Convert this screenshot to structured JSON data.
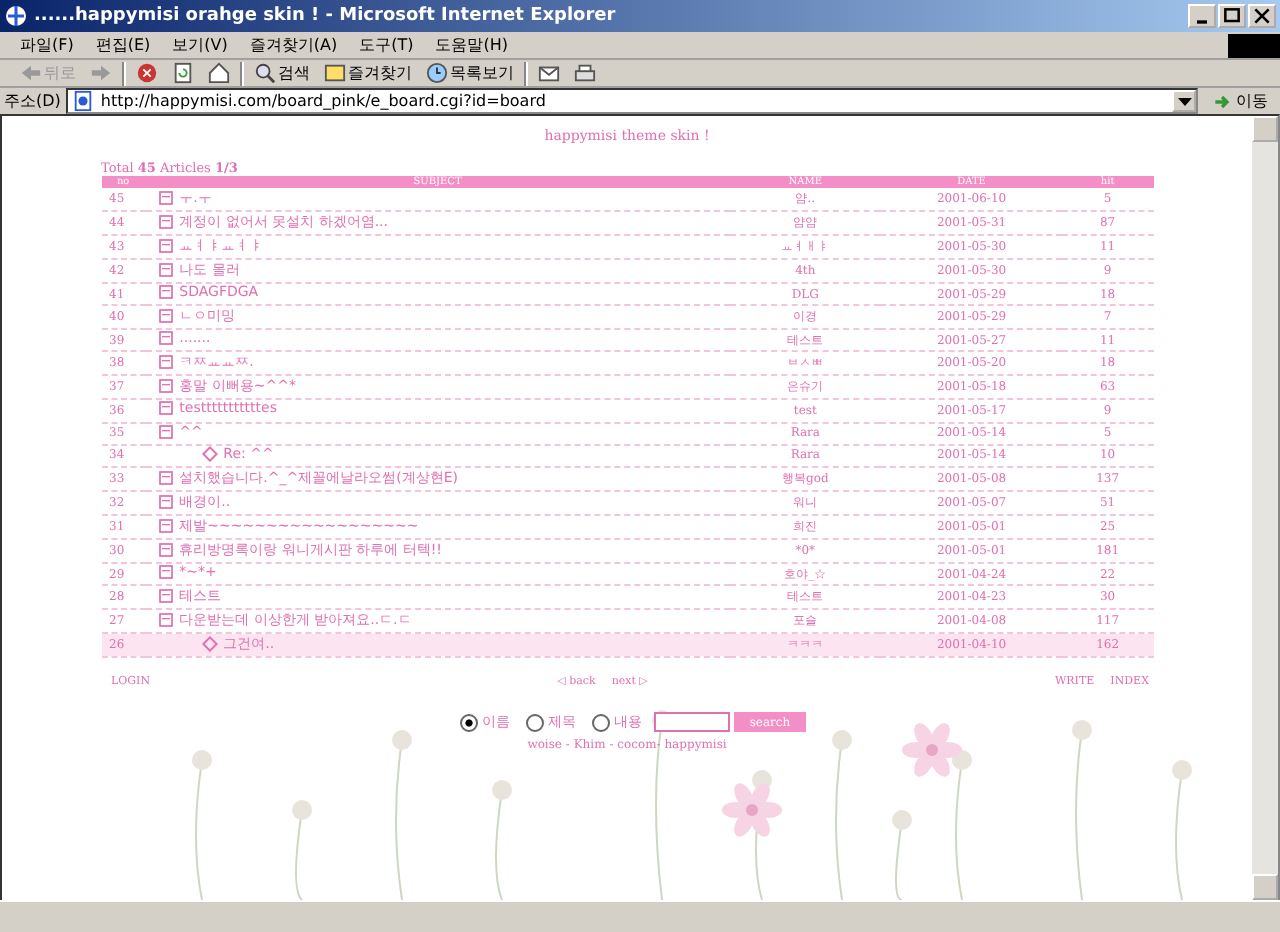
{
  "window": {
    "title": "......happymisi orahge skin ! - Microsoft Internet Explorer"
  },
  "menu": [
    "파일(F)",
    "편집(E)",
    "보기(V)",
    "즐겨찾기(A)",
    "도구(T)",
    "도움말(H)"
  ],
  "toolbar": [
    {
      "kind": "back",
      "label": "뒤로"
    },
    {
      "kind": "forward"
    },
    {
      "kind": "stop"
    },
    {
      "kind": "refresh"
    },
    {
      "kind": "home"
    },
    {
      "kind": "search",
      "label": "검색"
    },
    {
      "kind": "favorites",
      "label": "즐겨찾기"
    },
    {
      "kind": "history",
      "label": "목록보기"
    },
    {
      "kind": "mail"
    },
    {
      "kind": "print"
    }
  ],
  "address": {
    "label": "주소(D)",
    "value": "http://happymisi.com/board_pink/e_board.cgi?id=board",
    "go": "이동"
  },
  "board": {
    "title": "happymisi theme skin !",
    "total": "Total **45** Articles **1/3**",
    "columns": [
      "no",
      "SUBJECT",
      "NAME",
      "DATE",
      "hit"
    ],
    "rows": [
      {
        "no": "45",
        "kind": "post",
        "subject": "ㅜ.ㅜ",
        "name": "얌..",
        "date": "2001-06-10",
        "hits": "5",
        "selected": false
      },
      {
        "no": "44",
        "kind": "post",
        "subject": "계정이 없어서 못설치 하겠어염...",
        "name": "얌얌",
        "date": "2001-05-31",
        "hits": "87",
        "selected": false
      },
      {
        "no": "43",
        "kind": "post",
        "subject": "ㅛㅕㅑㅛㅕㅑ",
        "name": "ㅛㅕㅐㅑ",
        "date": "2001-05-30",
        "hits": "11",
        "selected": false
      },
      {
        "no": "42",
        "kind": "post",
        "subject": "나도 몰러",
        "name": "4th",
        "date": "2001-05-30",
        "hits": "9",
        "selected": false
      },
      {
        "no": "41",
        "kind": "post",
        "subject": "SDAGFDGA",
        "name": "DLG",
        "date": "2001-05-29",
        "hits": "18",
        "selected": false
      },
      {
        "no": "40",
        "kind": "post",
        "subject": "ㄴㅇ미밍",
        "name": "이경",
        "date": "2001-05-29",
        "hits": "7",
        "selected": false
      },
      {
        "no": "39",
        "kind": "post",
        "subject": ".......",
        "name": "테스트",
        "date": "2001-05-27",
        "hits": "11",
        "selected": false
      },
      {
        "no": "38",
        "kind": "post",
        "subject": "ㅋㅉㅛㅛㅉ.",
        "name": "ㅂㅅㅃ",
        "date": "2001-05-20",
        "hits": "18",
        "selected": false
      },
      {
        "no": "37",
        "kind": "post",
        "subject": "홍말 이뻐용~^^*",
        "name": "은슈기",
        "date": "2001-05-18",
        "hits": "63",
        "selected": false
      },
      {
        "no": "36",
        "kind": "post",
        "subject": "testttttttttttes",
        "name": "test",
        "date": "2001-05-17",
        "hits": "9",
        "selected": false
      },
      {
        "no": "35",
        "kind": "post",
        "subject": "^^",
        "name": "Rara",
        "date": "2001-05-14",
        "hits": "5",
        "selected": false
      },
      {
        "no": "34",
        "kind": "reply",
        "subject": "Re: ^^",
        "name": "Rara",
        "date": "2001-05-14",
        "hits": "10",
        "selected": false
      },
      {
        "no": "33",
        "kind": "post",
        "subject": "설치했습니다.^_^제꼴에날라오썸(계상현E)",
        "name": "행복god",
        "date": "2001-05-08",
        "hits": "137",
        "selected": false
      },
      {
        "no": "32",
        "kind": "post",
        "subject": "배경이..",
        "name": "워니",
        "date": "2001-05-07",
        "hits": "51",
        "selected": false
      },
      {
        "no": "31",
        "kind": "post",
        "subject": "제발~~~~~~~~~~~~~~~~~~",
        "name": "희진",
        "date": "2001-05-01",
        "hits": "25",
        "selected": false
      },
      {
        "no": "30",
        "kind": "post",
        "subject": "휴리방명록이랑 워니게시판 하루에 터텍!!",
        "name": "*0*",
        "date": "2001-05-01",
        "hits": "181",
        "selected": false
      },
      {
        "no": "29",
        "kind": "post",
        "subject": "*~*+",
        "name": "호야_☆",
        "date": "2001-04-24",
        "hits": "22",
        "selected": false
      },
      {
        "no": "28",
        "kind": "post",
        "subject": "테스트",
        "name": "테스트",
        "date": "2001-04-23",
        "hits": "30",
        "selected": false
      },
      {
        "no": "27",
        "kind": "post",
        "subject": "다운받는데 이상한게 받아져요..ㄷ.ㄷ",
        "name": "포슬",
        "date": "2001-04-08",
        "hits": "117",
        "selected": false
      },
      {
        "no": "26",
        "kind": "reply",
        "subject": "그건여..",
        "name": "ㅋㅋㅋ",
        "date": "2001-04-10",
        "hits": "162",
        "selected": true
      }
    ]
  },
  "footer": {
    "login": "LOGIN",
    "back": "◁ back",
    "next": "next ▷",
    "write": "WRITE",
    "index": "INDEX"
  },
  "search": {
    "options": [
      {
        "label": "이름",
        "selected": true
      },
      {
        "label": "제목",
        "selected": false
      },
      {
        "label": "내용",
        "selected": false
      }
    ],
    "button": "search"
  },
  "credits": "woise - Khim - cocom- happymisi"
}
